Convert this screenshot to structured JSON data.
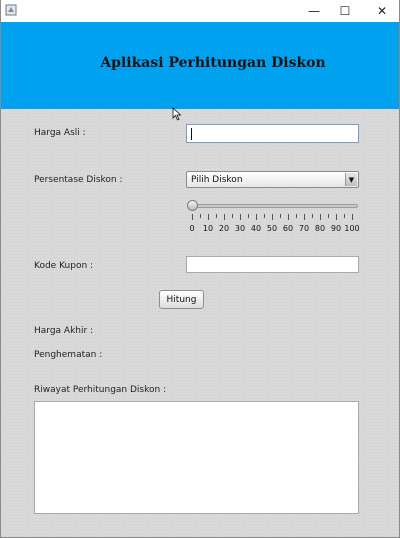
{
  "window": {
    "controls": {
      "minimize": "—",
      "maximize": "☐",
      "close": "✕"
    }
  },
  "header": {
    "title": "Aplikasi Perhitungan Diskon",
    "background": "#00a2f0"
  },
  "form": {
    "harga_asli_label": "Harga Asli :",
    "harga_asli_value": "",
    "persentase_label": "Persentase Diskon :",
    "persentase_selected": "Pilih Diskon",
    "slider": {
      "value": 0,
      "min": 0,
      "max": 100,
      "tick_labels": [
        "0",
        "10",
        "20",
        "30",
        "40",
        "50",
        "60",
        "70",
        "80",
        "90",
        "100"
      ]
    },
    "kupon_label": "Kode Kupon :",
    "kupon_value": "",
    "hitung_label": "Hitung",
    "harga_akhir_label": "Harga Akhir :",
    "penghematan_label": "Penghematan :",
    "riwayat_label": "Riwayat Perhitungan Diskon :",
    "riwayat_value": ""
  }
}
